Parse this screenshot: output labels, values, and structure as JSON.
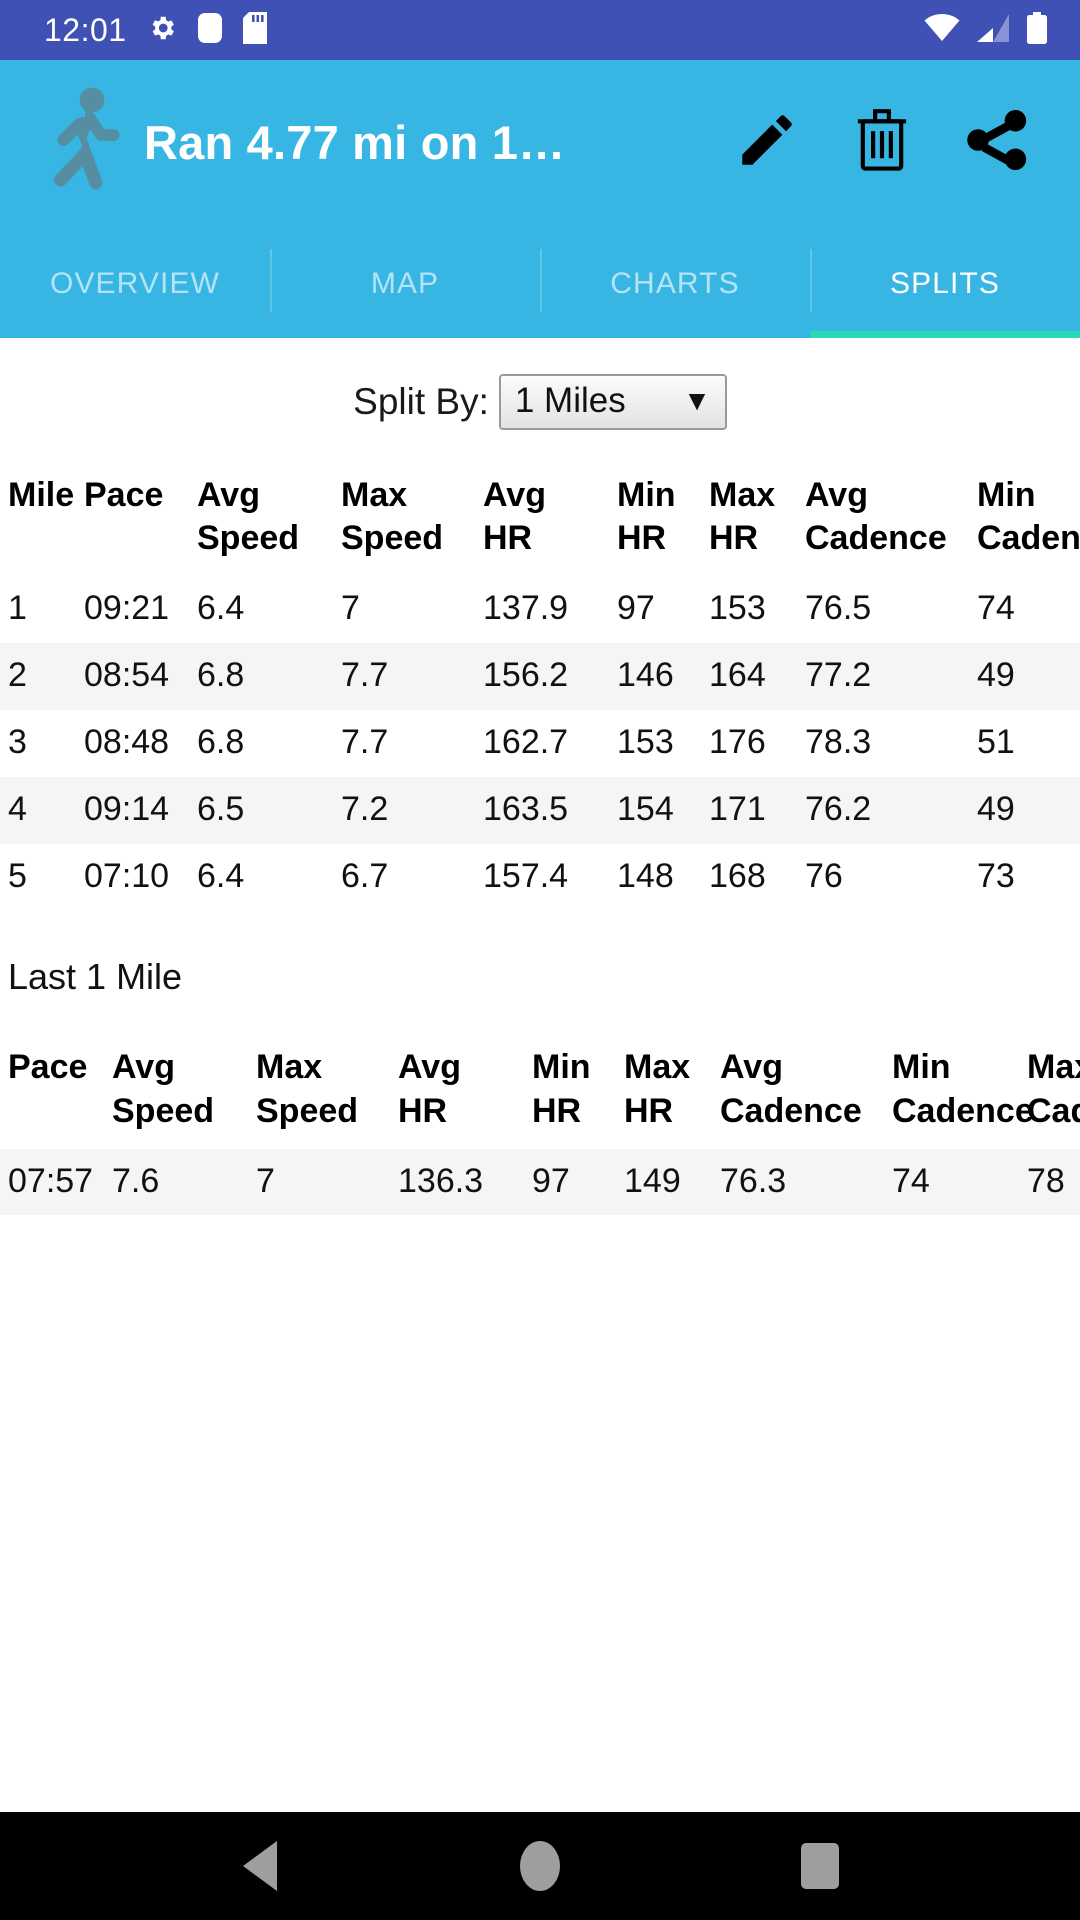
{
  "status_bar": {
    "time": "12:01",
    "left_icons": [
      "gear-icon",
      "rounded-square-icon",
      "sd-card-icon"
    ],
    "right_icons": [
      "wifi-icon",
      "cellular-signal-icon",
      "battery-icon"
    ],
    "background_color": "#3f51b5"
  },
  "app_bar": {
    "activity_icon": "running-person-icon",
    "title": "Ran 4.77 mi on 1…",
    "background_color": "#38b6e3",
    "actions": [
      {
        "name": "edit-button",
        "icon": "pencil-icon"
      },
      {
        "name": "delete-button",
        "icon": "trash-icon"
      },
      {
        "name": "share-button",
        "icon": "share-icon"
      }
    ]
  },
  "tabs": {
    "items": [
      {
        "label": "OVERVIEW",
        "active": false
      },
      {
        "label": "MAP",
        "active": false
      },
      {
        "label": "CHARTS",
        "active": false
      },
      {
        "label": "SPLITS",
        "active": true
      }
    ],
    "indicator_color": "#26d9b8"
  },
  "split_by": {
    "label": "Split By:",
    "value": "1 Miles",
    "arrow": "▼",
    "options": [
      "1 Miles"
    ]
  },
  "splits_table": {
    "headers": [
      "Mile",
      "Pace",
      "Avg Speed",
      "Max Speed",
      "Avg HR",
      "Min HR",
      "Max HR",
      "Avg Cadence",
      "Min Cadence"
    ],
    "header_lines": [
      [
        "Mile",
        ""
      ],
      [
        "Pace",
        ""
      ],
      [
        "Avg",
        "Speed"
      ],
      [
        "Max",
        "Speed"
      ],
      [
        "Avg",
        "HR"
      ],
      [
        "Min",
        "HR"
      ],
      [
        "Max",
        "HR"
      ],
      [
        "Avg",
        "Cadence"
      ],
      [
        "Min",
        "Cadence"
      ]
    ],
    "rows": [
      [
        "1",
        "09:21",
        "6.4",
        "7",
        "137.9",
        "97",
        "153",
        "76.5",
        "74"
      ],
      [
        "2",
        "08:54",
        "6.8",
        "7.7",
        "156.2",
        "146",
        "164",
        "77.2",
        "49"
      ],
      [
        "3",
        "08:48",
        "6.8",
        "7.7",
        "162.7",
        "153",
        "176",
        "78.3",
        "51"
      ],
      [
        "4",
        "09:14",
        "6.5",
        "7.2",
        "163.5",
        "154",
        "171",
        "76.2",
        "49"
      ],
      [
        "5",
        "07:10",
        "6.4",
        "6.7",
        "157.4",
        "148",
        "168",
        "76",
        "73"
      ]
    ]
  },
  "last_section": {
    "title": "Last 1 Mile",
    "headers": [
      "Pace",
      "Avg Speed",
      "Max Speed",
      "Avg HR",
      "Min HR",
      "Max HR",
      "Avg Cadence",
      "Min Cadence",
      "Max Cadence"
    ],
    "header_lines": [
      [
        "Pace",
        ""
      ],
      [
        "Avg",
        "Speed"
      ],
      [
        "Max",
        "Speed"
      ],
      [
        "Avg",
        "HR"
      ],
      [
        "Min",
        "HR"
      ],
      [
        "Max",
        "HR"
      ],
      [
        "Avg",
        "Cadence"
      ],
      [
        "Min",
        "Cadence"
      ],
      [
        "Max",
        "Cadence"
      ]
    ],
    "rows": [
      [
        "07:57",
        "7.6",
        "7",
        "136.3",
        "97",
        "149",
        "76.3",
        "74",
        "78"
      ]
    ]
  },
  "nav_bar": {
    "buttons": [
      {
        "name": "nav-back-button",
        "icon": "triangle-back-icon"
      },
      {
        "name": "nav-home-button",
        "icon": "circle-home-icon"
      },
      {
        "name": "nav-recents-button",
        "icon": "square-recents-icon"
      }
    ]
  }
}
